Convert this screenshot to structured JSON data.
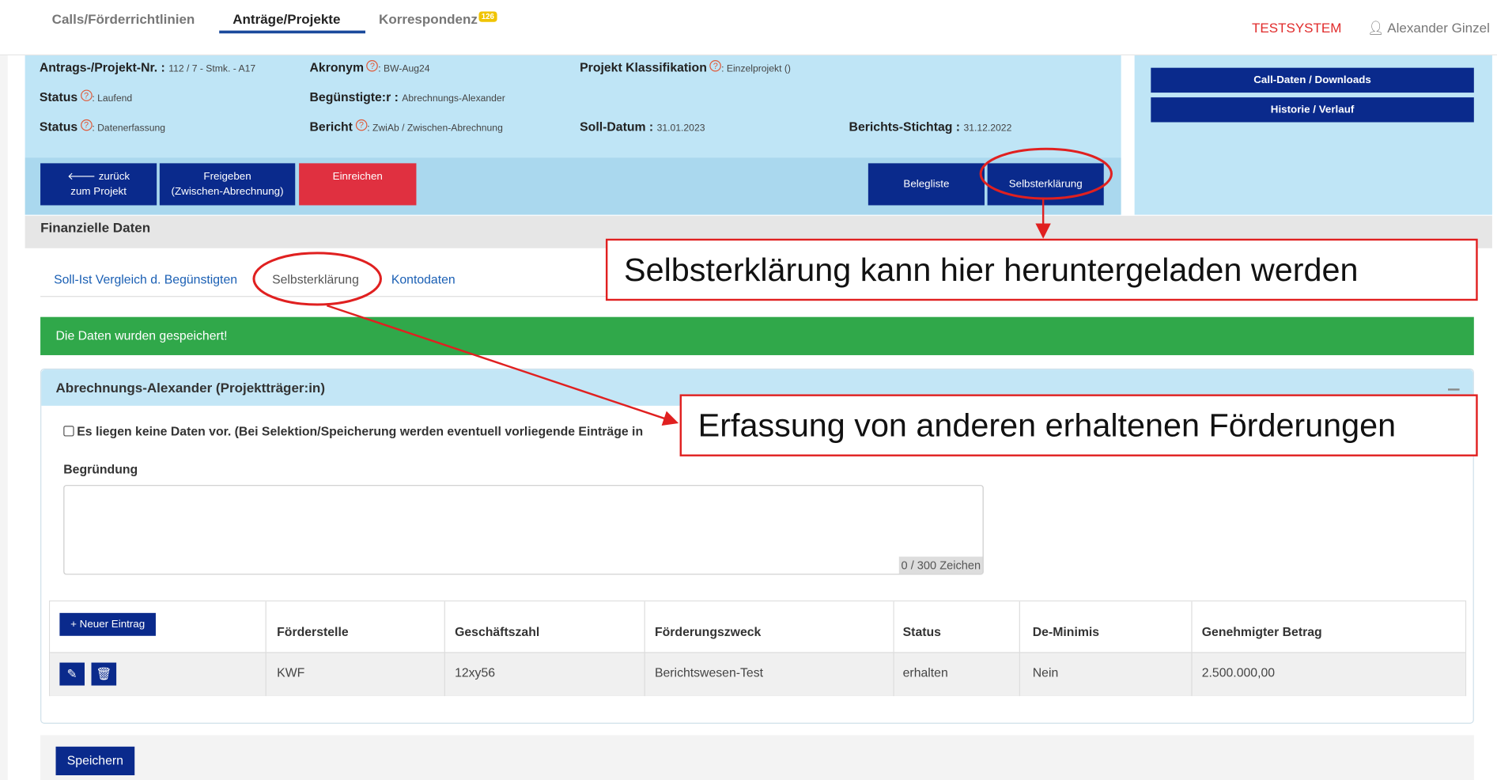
{
  "nav": {
    "items": [
      "Calls/Förderrichtlinien",
      "Anträge/Projekte",
      "Korrespondenz"
    ],
    "badge": "126",
    "testsystem": "TESTSYSTEM",
    "user": "Alexander Ginzel"
  },
  "project": {
    "nr_label": "Antrags-/Projekt-Nr. :",
    "nr_value": "112 / 7 - Stmk. - A17",
    "akronym_label": "Akronym",
    "akronym_value": ": BW-Aug24",
    "klass_label": "Projekt Klassifikation",
    "klass_value": ": Einzelprojekt ()",
    "status1_label": "Status",
    "status1_value": ": Laufend",
    "beg_label": "Begünstigte:r :",
    "beg_value": "Abrechnungs-Alexander",
    "status2_label": "Status",
    "status2_value": ": Datenerfassung",
    "bericht_label": "Bericht",
    "bericht_value": ": ZwiAb / Zwischen-Abrechnung",
    "soll_label": "Soll-Datum :",
    "soll_value": "31.01.2023",
    "stichtag_label": "Berichts-Stichtag :",
    "stichtag_value": "31.12.2022",
    "help_glyph": "?"
  },
  "buttons": {
    "back_line1": "🡐 zurück",
    "back_line2": "zum Projekt",
    "freigeben_line1": "Freigeben",
    "freigeben_line2": "(Zwischen-Abrechnung)",
    "einreichen": "Einreichen",
    "belegliste": "Belegliste",
    "selbsterklaerung": "Selbsterklärung",
    "calldaten": "Call-Daten / Downloads",
    "historie": "Historie / Verlauf"
  },
  "section": {
    "title": "Finanzielle Daten",
    "tabs": [
      "Soll-Ist Vergleich d. Begünstigten",
      "Selbsterklärung",
      "Kontodaten"
    ]
  },
  "alert": "Die Daten wurden gespeichert!",
  "panel": {
    "title": "Abrechnungs-Alexander (Projektträger:in)",
    "checkbox_label": "Es liegen keine Daten vor. (Bei Selektion/Speicherung werden eventuell vorliegende Einträge in",
    "begruendung_label": "Begründung",
    "begruendung_value": "",
    "counter": "0 / 300 Zeichen"
  },
  "table": {
    "new_button": "+ Neuer Eintrag",
    "columns": [
      "Förderstelle",
      "Geschäftszahl",
      "Förderungszweck",
      "Status",
      "De-Minimis",
      "Genehmigter Betrag"
    ],
    "rows": [
      [
        "KWF",
        "12xy56",
        "Berichtswesen-Test",
        "erhalten",
        "Nein",
        "2.500.000,00"
      ]
    ],
    "edit_glyph": "✎",
    "delete_glyph": "🗑"
  },
  "save": "Speichern",
  "annotations": {
    "callout1": "Selbsterklärung kann hier heruntergeladen werden",
    "callout2": "Erfassung von anderen erhaltenen Förderungen"
  },
  "colors": {
    "primary": "#0a2a8c",
    "danger": "#e03040",
    "success": "#30a84a",
    "info_bg": "#bfe5f6",
    "annotation": "#e02020"
  }
}
